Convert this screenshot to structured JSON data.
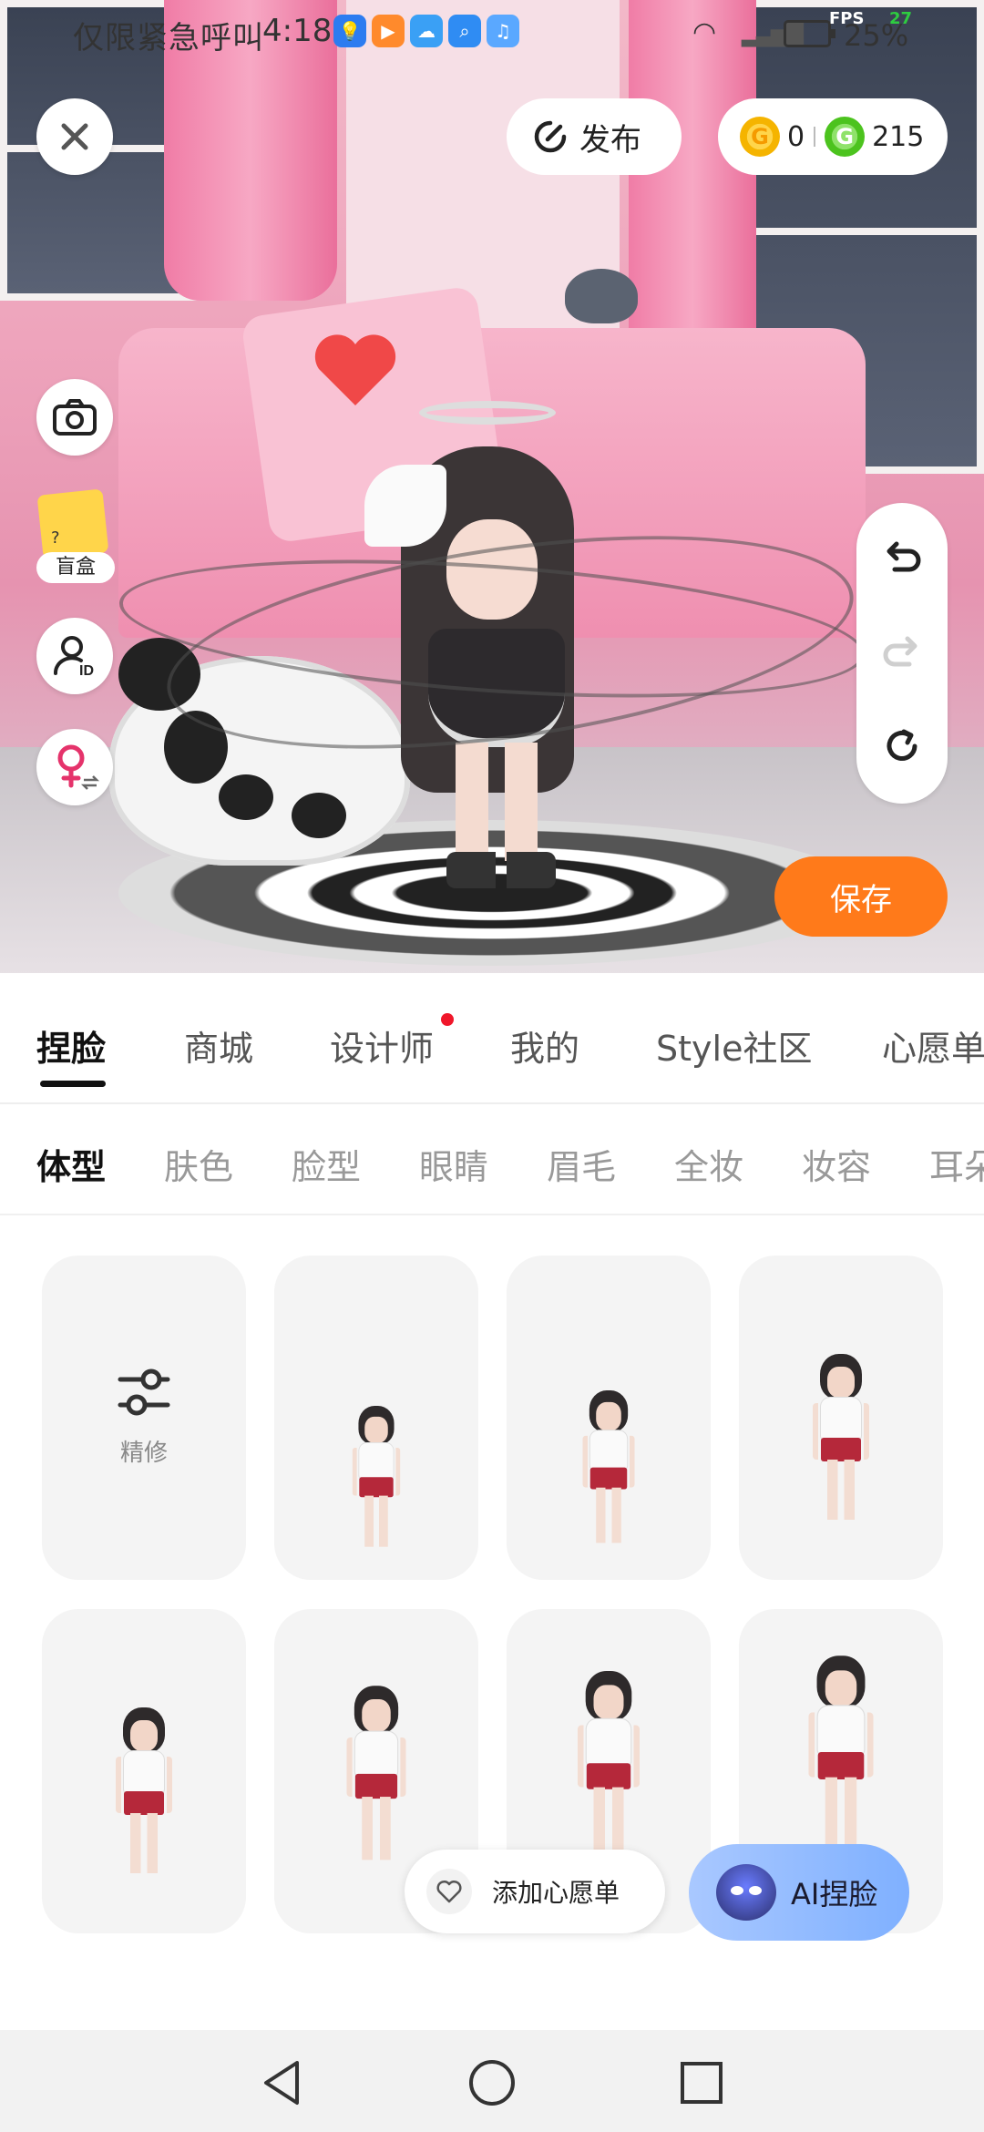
{
  "status_bar": {
    "carrier_text": "仅限紧急呼叫",
    "time": "4:18",
    "fps_label": "FPS",
    "fps_value": "27",
    "battery": "25%"
  },
  "top_bar": {
    "close_icon": "close-icon",
    "publish_label": "发布",
    "gold_coin_count": "0",
    "green_coin_count": "215"
  },
  "left_tools": {
    "blind_box_label": "盲盒"
  },
  "right_tools": {
    "save_label": "保存"
  },
  "tabs": [
    {
      "label": "捏脸"
    },
    {
      "label": "商城"
    },
    {
      "label": "设计师"
    },
    {
      "label": "我的"
    },
    {
      "label": "Style社区"
    },
    {
      "label": "心愿单"
    }
  ],
  "subtabs": [
    {
      "label": "体型"
    },
    {
      "label": "肤色"
    },
    {
      "label": "脸型"
    },
    {
      "label": "眼睛"
    },
    {
      "label": "眉毛"
    },
    {
      "label": "全妆"
    },
    {
      "label": "妆容"
    },
    {
      "label": "耳朵"
    }
  ],
  "grid": {
    "refine_label": "精修"
  },
  "floating": {
    "wishlist_label": "添加心愿单",
    "ai_label": "AI捏脸"
  },
  "colors": {
    "accent_orange": "#ff7a1a",
    "notification_red": "#f0172a",
    "ai_button_blue": "#7fb0ff"
  }
}
